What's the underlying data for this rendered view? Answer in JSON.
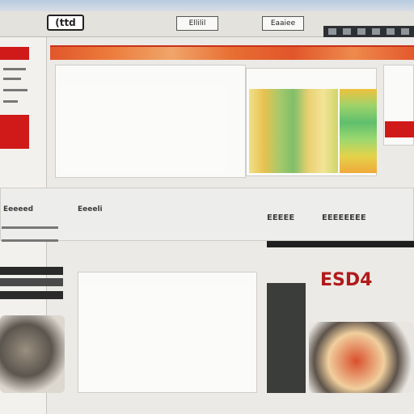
{
  "header": {
    "logo_text": "(ttd",
    "tabs": [
      "Ellilil",
      "Eaaiee"
    ]
  },
  "toolbar": {
    "icon_names": [
      "tool-icon-1",
      "tool-icon-2",
      "tool-icon-3",
      "tool-icon-4",
      "tool-icon-5",
      "tool-icon-6"
    ]
  },
  "panels": {
    "top_left_text": "",
    "top_right_text": "",
    "bottom_text": ""
  },
  "labels": {
    "left_heading": "Eeeeed",
    "mid_heading": "Eeeeli",
    "right_heading_1": "EEEEE",
    "right_heading_2": "EEEEEEEE",
    "side_title": "ESD4"
  },
  "colors": {
    "accent": "#d01a1a",
    "band": "#e1562a",
    "heatmap_high": "#7fbf6a",
    "heatmap_low": "#f0e08a"
  }
}
